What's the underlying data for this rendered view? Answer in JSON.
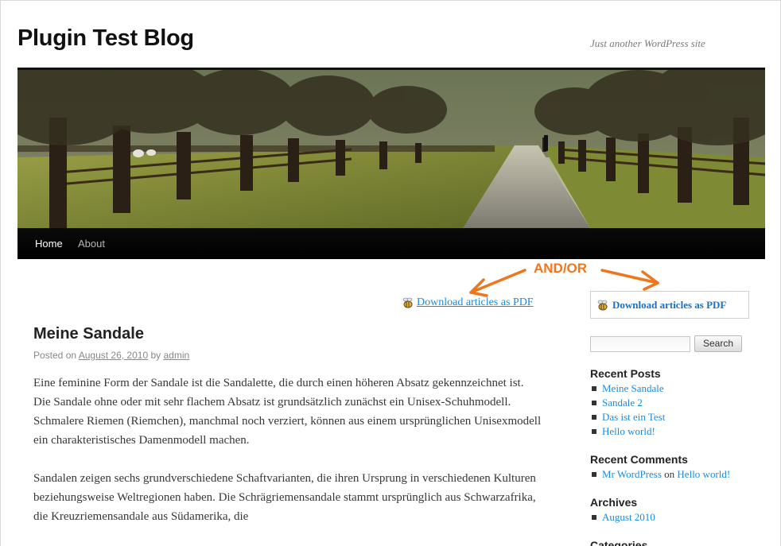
{
  "site": {
    "title": "Plugin Test Blog",
    "description": "Just another WordPress site"
  },
  "nav": {
    "home": "Home",
    "about": "About"
  },
  "annotation": {
    "label": "AND/OR",
    "color": "#f0761d"
  },
  "download": {
    "inline_label": "Download articles as PDF",
    "widget_label": "Download articles as PDF",
    "icon": "pdf-bee-icon"
  },
  "post": {
    "title": "Meine Sandale",
    "posted_on": "Posted on",
    "date": "August 26, 2010",
    "by": "by",
    "author": "admin",
    "paragraphs": [
      "Eine feminine Form der Sandale ist die Sandalette, die durch einen höheren Absatz gekennzeichnet ist. Die Sandale ohne oder mit sehr flachem Absatz ist grundsätzlich zunächst ein Unisex-Schuhmodell. Schmalere Riemen (Riemchen), manchmal noch verziert, können aus einem ursprünglichen Unisexmodell ein charakteristisches Damenmodell machen.",
      "Sandalen zeigen sechs grundverschiedene Schaftvarianten, die ihren Ursprung in verschiedenen Kulturen beziehungsweise Weltregionen haben. Die Schrägriemensandale stammt ursprünglich aus Schwarzafrika, die Kreuzriemensandale aus Südamerika, die"
    ]
  },
  "sidebar": {
    "search_button": "Search",
    "recent_posts_title": "Recent Posts",
    "recent_posts": [
      "Meine Sandale",
      "Sandale 2",
      "Das ist ein Test",
      "Hello world!"
    ],
    "recent_comments_title": "Recent Comments",
    "recent_comment": {
      "author": "Mr WordPress",
      "on": "on",
      "post": "Hello world!"
    },
    "archives_title": "Archives",
    "archives": [
      "August 2010"
    ],
    "categories_title": "Categories"
  }
}
